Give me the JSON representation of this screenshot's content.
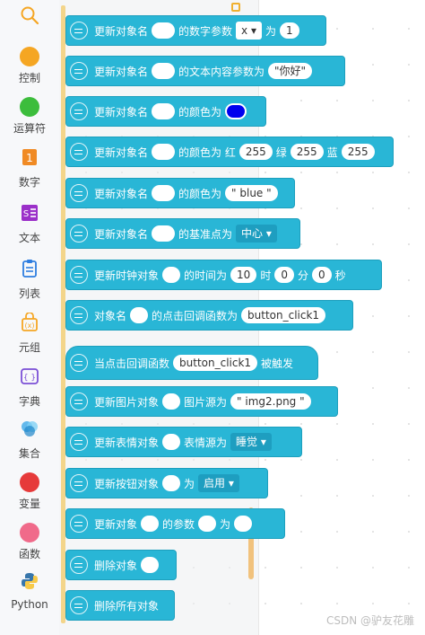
{
  "sidebar": {
    "categories": [
      {
        "label": "控制",
        "icon": "control-dot",
        "color": "#f5a623"
      },
      {
        "label": "运算符",
        "icon": "operator-dot",
        "color": "#3cbd3c"
      },
      {
        "label": "数字",
        "icon": "number-icon",
        "color": "#f08a24"
      },
      {
        "label": "文本",
        "icon": "text-icon",
        "color": "#9b30c9"
      },
      {
        "label": "列表",
        "icon": "list-icon",
        "color": "#2d7de0"
      },
      {
        "label": "元组",
        "icon": "tuple-icon",
        "color": "#f5a623"
      },
      {
        "label": "字典",
        "icon": "dict-icon",
        "color": "#7b4fd6"
      },
      {
        "label": "集合",
        "icon": "set-icon",
        "color": "#3da9e8"
      },
      {
        "label": "变量",
        "icon": "variable-dot",
        "color": "#e63a3a"
      },
      {
        "label": "函数",
        "icon": "function-dot",
        "color": "#f06a8a"
      },
      {
        "label": "Python",
        "icon": "python-icon",
        "color": "#3776ab"
      }
    ]
  },
  "blocks": {
    "b1": {
      "label": "更新对象名",
      "text2": "的数字参数",
      "param": "x",
      "text3": "为",
      "value": "1"
    },
    "b2": {
      "label": "更新对象名",
      "text2": "的文本内容参数为",
      "value": "\"你好\""
    },
    "b3": {
      "label": "更新对象名",
      "text2": "的颜色为",
      "color": "#0000ee"
    },
    "b4": {
      "label": "更新对象名",
      "text2": "的颜色为 红",
      "r": "255",
      "g_label": "绿",
      "g": "255",
      "b_label": "蓝",
      "b": "255"
    },
    "b5": {
      "label": "更新对象名",
      "text2": "的颜色为",
      "value": "\" blue \""
    },
    "b6": {
      "label": "更新对象名",
      "text2": "的基准点为",
      "anchor": "中心"
    },
    "b7": {
      "label": "更新时钟对象",
      "text2": "的时间为",
      "hour": "10",
      "hour_label": "时",
      "minute": "0",
      "minute_label": "分",
      "second": "0",
      "second_label": "秒"
    },
    "b8": {
      "label": "对象名",
      "text2": "的点击回调函数为",
      "value": "button_click1"
    },
    "b9": {
      "label": "当点击回调函数",
      "value": "button_click1",
      "text2": "被触发"
    },
    "b10": {
      "label": "更新图片对象",
      "text2": "图片源为",
      "value": "\" img2.png \""
    },
    "b11": {
      "label": "更新表情对象",
      "text2": "表情源为",
      "value": "睡觉"
    },
    "b12": {
      "label": "更新按钮对象",
      "text2": "为",
      "value": "启用"
    },
    "b13": {
      "label": "更新对象",
      "text2": "的参数",
      "text3": "为"
    },
    "b14": {
      "label": "删除对象"
    },
    "b15": {
      "label": "删除所有对象"
    }
  },
  "watermark": "CSDN @驴友花雕"
}
